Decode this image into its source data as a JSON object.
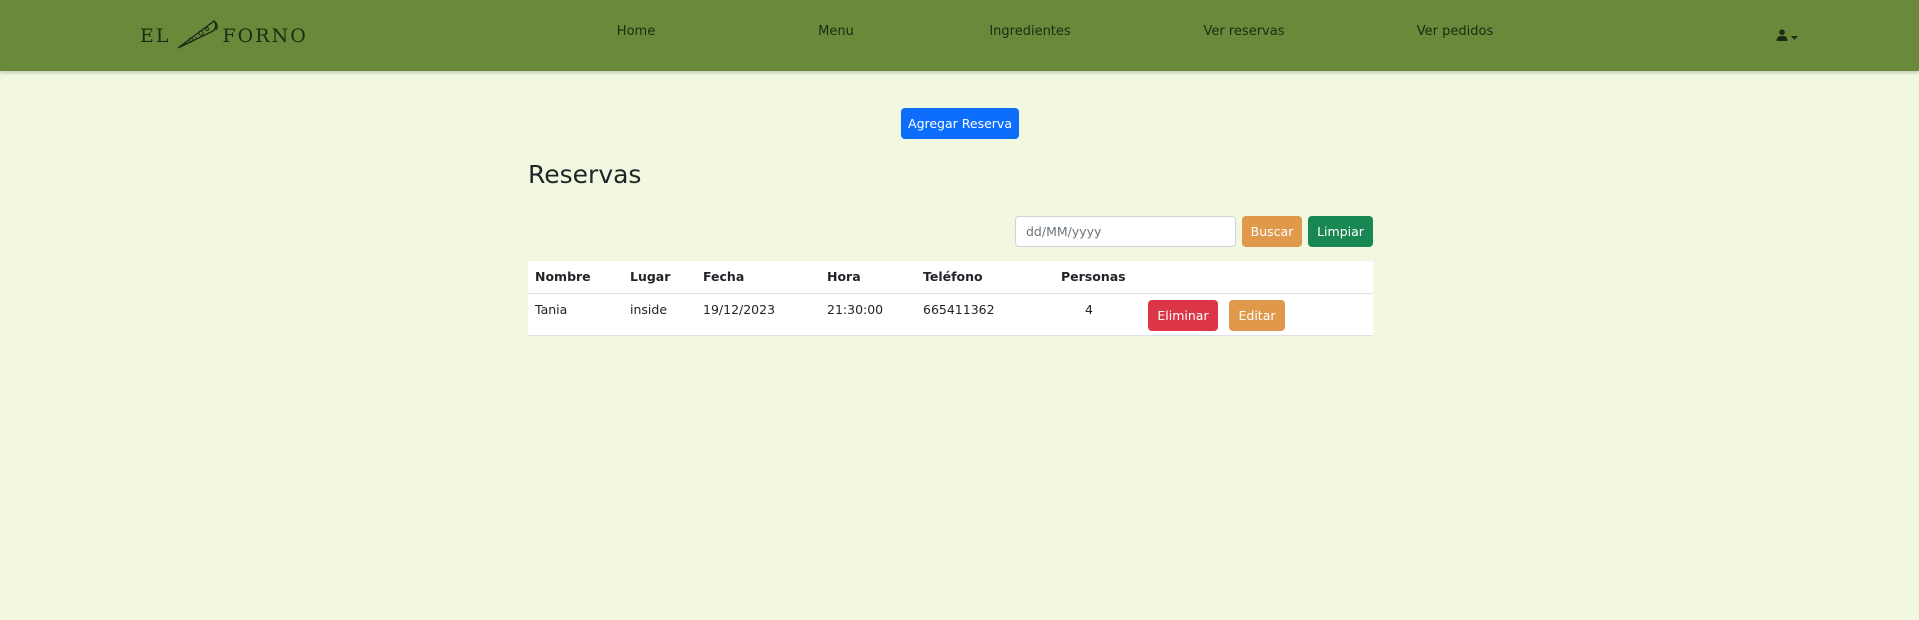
{
  "nav": {
    "brand": {
      "left": "EL",
      "right": "FORNO"
    },
    "links": [
      "Home",
      "Menu",
      "Ingredientes",
      "Ver reservas",
      "Ver pedidos"
    ],
    "user_icon": "user-icon",
    "dropdown_icon": "caret-down-icon"
  },
  "actions": {
    "add_label": "Agregar Reserva"
  },
  "page": {
    "title": "Reservas"
  },
  "search": {
    "placeholder": "dd/MM/yyyy",
    "value": "",
    "search_label": "Buscar",
    "clear_label": "Limpiar"
  },
  "table": {
    "headers": [
      "Nombre",
      "Lugar",
      "Fecha",
      "Hora",
      "Teléfono",
      "Personas"
    ],
    "rows": [
      {
        "nombre": "Tania",
        "lugar": "inside",
        "fecha": "19/12/2023",
        "hora": "21:30:00",
        "telefono": "665411362",
        "personas": "4",
        "delete_label": "Eliminar",
        "edit_label": "Editar"
      }
    ]
  },
  "colors": {
    "navbar": "#6a8a3b",
    "background": "#f1f8df",
    "primary": "#0d6efd",
    "warning": "#e0994b",
    "success": "#198754",
    "danger": "#dc3545"
  }
}
